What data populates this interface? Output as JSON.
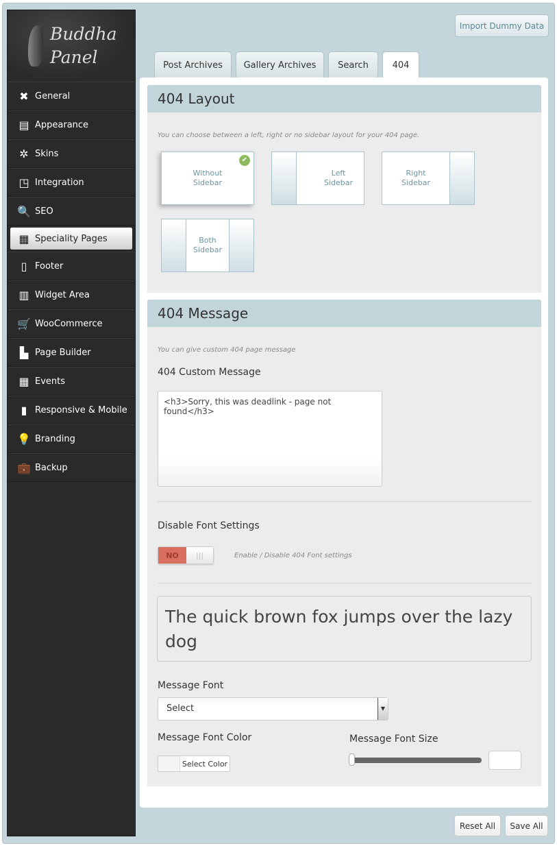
{
  "brand": {
    "line1": "Buddha",
    "line2": "Panel"
  },
  "sidebar": {
    "items": [
      {
        "label": "General",
        "icon": "wrench-icon",
        "glyph": "✖"
      },
      {
        "label": "Appearance",
        "icon": "newspaper-icon",
        "glyph": "▤"
      },
      {
        "label": "Skins",
        "icon": "ship-wheel-icon",
        "glyph": "✲"
      },
      {
        "label": "Integration",
        "icon": "browser-cursor-icon",
        "glyph": "◳"
      },
      {
        "label": "SEO",
        "icon": "search-icon",
        "glyph": "🔍"
      },
      {
        "label": "Speciality Pages",
        "icon": "grid-icon",
        "glyph": "▦"
      },
      {
        "label": "Footer",
        "icon": "footer-icon",
        "glyph": "▯"
      },
      {
        "label": "Widget Area",
        "icon": "widget-icon",
        "glyph": "▥"
      },
      {
        "label": "WooCommerce",
        "icon": "cart-icon",
        "glyph": "🛒"
      },
      {
        "label": "Page Builder",
        "icon": "page-add-icon",
        "glyph": "▙"
      },
      {
        "label": "Events",
        "icon": "calendar-icon",
        "glyph": "▦"
      },
      {
        "label": "Responsive & Mobile",
        "icon": "tablet-icon",
        "glyph": "▮"
      },
      {
        "label": "Branding",
        "icon": "lightbulb-icon",
        "glyph": "💡"
      },
      {
        "label": "Backup",
        "icon": "briefcase-icon",
        "glyph": "💼"
      }
    ],
    "active": "Speciality Pages"
  },
  "header": {
    "import_label": "Import Dummy Data"
  },
  "tabs": [
    {
      "label": "Post Archives"
    },
    {
      "label": "Gallery Archives"
    },
    {
      "label": "Search"
    },
    {
      "label": "404"
    }
  ],
  "active_tab": "404",
  "layout_section": {
    "title": "404 Layout",
    "hint": "You can choose between a left, right or no sidebar layout for your 404 page.",
    "options": [
      {
        "line1": "Without",
        "line2": "Sidebar",
        "selected": true
      },
      {
        "line1": "Left",
        "line2": "Sidebar"
      },
      {
        "line1": "Right",
        "line2": "Sidebar"
      },
      {
        "line1": "Both",
        "line2": "Sidebar"
      }
    ]
  },
  "message_section": {
    "title": "404 Message",
    "hint": "You can give custom 404 page message",
    "custom_label": "404 Custom Message",
    "custom_value": "<h3>Sorry, this was deadlink - page not found</h3>",
    "disable_label": "Disable Font Settings",
    "toggle_value": "NO",
    "toggle_hint": "Enable / Disable 404 Font settings",
    "preview": "The quick brown fox jumps over the lazy dog",
    "font_label": "Message Font",
    "font_value": "Select",
    "color_label": "Message Font Color",
    "color_button": "Select Color",
    "size_label": "Message Font Size",
    "size_value": "",
    "size_slider": 0
  },
  "footer": {
    "reset": "Reset All",
    "save": "Save All"
  },
  "colors": {
    "accent": "#c2d5da",
    "toggle_no": "#d9705f",
    "sidebar": "#2a2a2a"
  }
}
